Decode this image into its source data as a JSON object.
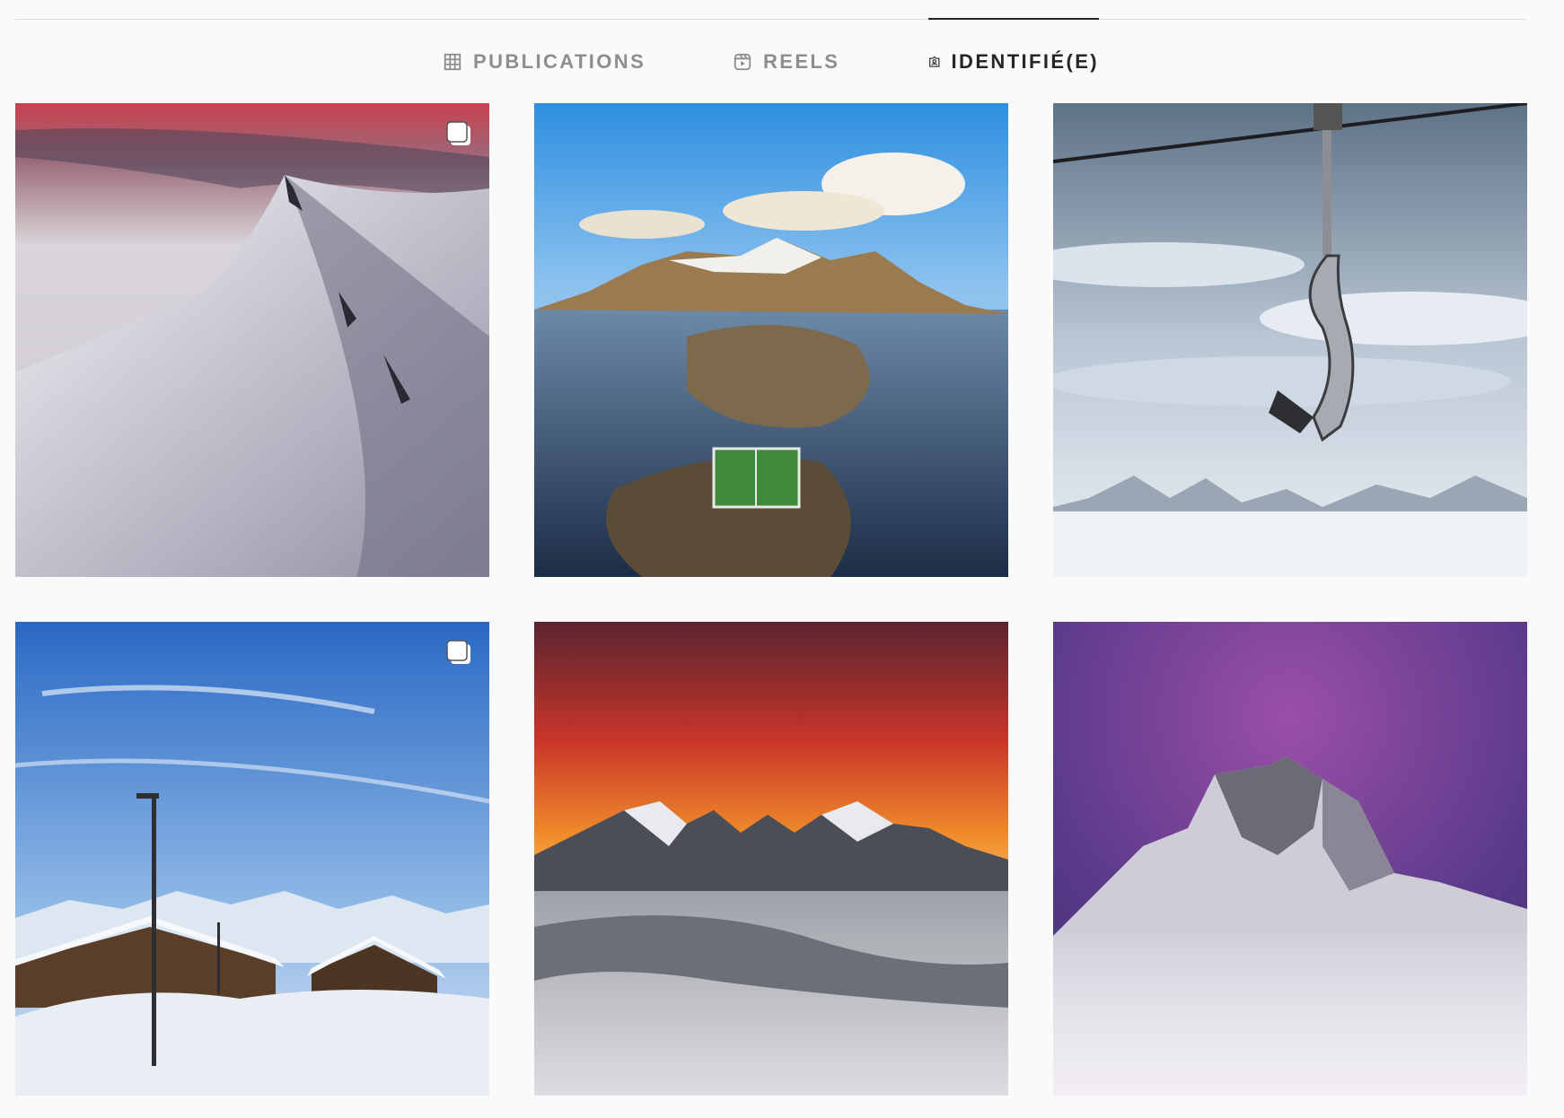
{
  "tabs": [
    {
      "label": "PUBLICATIONS",
      "icon": "grid-icon",
      "active": false
    },
    {
      "label": "REELS",
      "icon": "reels-icon",
      "active": false
    },
    {
      "label": "IDENTIFIÉ(E)",
      "icon": "tagged-icon",
      "active": true
    }
  ],
  "posts": [
    {
      "subject": "snowy mountain ridge with pink sky",
      "multi": true
    },
    {
      "subject": "aerial view of island village with football field",
      "multi": false
    },
    {
      "subject": "ski chairlift above clouds",
      "multi": false
    },
    {
      "subject": "snowy chalets with lamp posts under blue sky",
      "multi": true
    },
    {
      "subject": "mountain range at sunset above sea of clouds",
      "multi": false
    },
    {
      "subject": "snowy rocky peak under purple sky",
      "multi": false
    }
  ],
  "colors": {
    "background": "#fafafa",
    "tab_active": "#262626",
    "tab_inactive": "#8e8e8e",
    "divider": "#dbdbdb"
  }
}
